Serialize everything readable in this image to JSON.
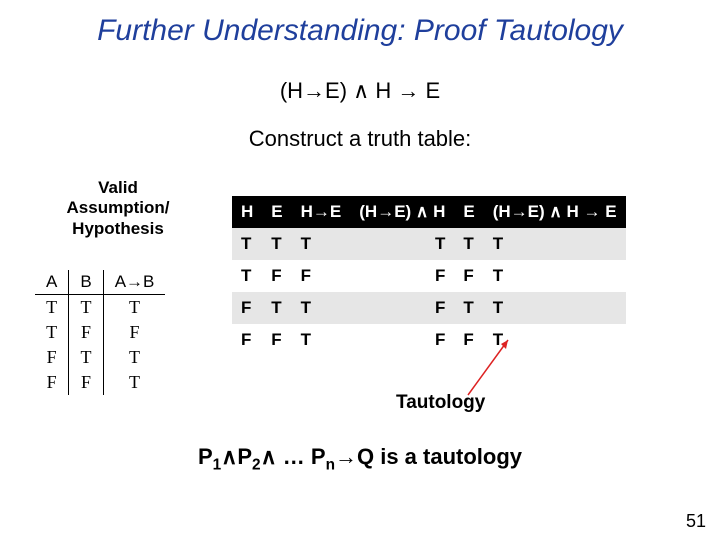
{
  "title": "Further Understanding: Proof Tautology",
  "formula": "(H→E) ∧ H → E",
  "construct": "Construct a truth table:",
  "valid_label": "Valid Assumption/ Hypothesis",
  "small_table": {
    "headers": [
      "A",
      "B",
      "A→B"
    ],
    "rows": [
      [
        "T",
        "T",
        "T"
      ],
      [
        "T",
        "F",
        "F"
      ],
      [
        "F",
        "T",
        "T"
      ],
      [
        "F",
        "F",
        "T"
      ]
    ]
  },
  "big_table": {
    "headers": [
      "H",
      "E",
      "H→E",
      "(H→E) ∧ H",
      "E",
      "(H→E) ∧ H → E"
    ],
    "rows": [
      [
        "T",
        "T",
        "T",
        "T",
        "T",
        "T"
      ],
      [
        "T",
        "F",
        "F",
        "F",
        "F",
        "T"
      ],
      [
        "F",
        "T",
        "T",
        "F",
        "T",
        "T"
      ],
      [
        "F",
        "F",
        "T",
        "F",
        "F",
        "T"
      ]
    ]
  },
  "tautology_label": "Tautology",
  "bottom_line": {
    "p1": "P",
    "s1": "1",
    "and": "∧",
    "p2": "P",
    "s2": "2",
    "dots": " … P",
    "sn": "n",
    "rest": "→Q is a tautology"
  },
  "page_num": "51"
}
